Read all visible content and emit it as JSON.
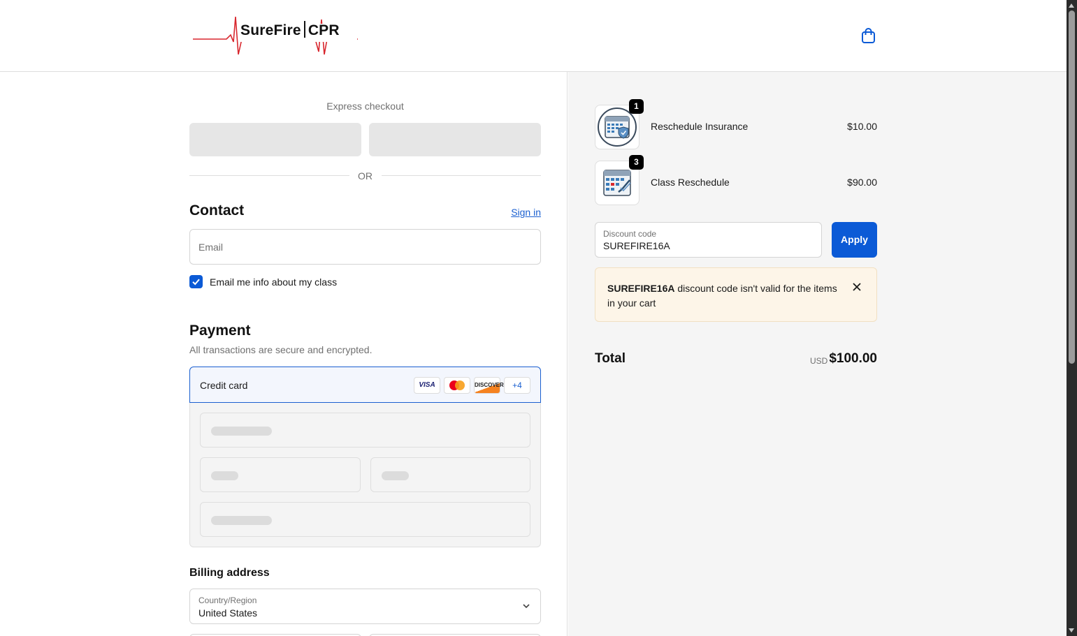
{
  "brand": {
    "logo_text_left": "SureFire",
    "logo_text_right": "CPR",
    "accent": "#0b5ad6",
    "logo_red": "#d8272e"
  },
  "header": {
    "cart_icon": "shopping-bag-icon"
  },
  "express": {
    "label": "Express checkout",
    "or": "OR"
  },
  "contact": {
    "title": "Contact",
    "signin": "Sign in",
    "email_placeholder": "Email",
    "opt_in_label": "Email me info about my class",
    "opt_in_checked": true
  },
  "payment": {
    "title": "Payment",
    "subtitle": "All transactions are secure and encrypted.",
    "method_label": "Credit card",
    "cards": [
      "VISA",
      "mastercard",
      "DISCOVER",
      "+4"
    ]
  },
  "billing": {
    "title": "Billing address",
    "country_label": "Country/Region",
    "country_value": "United States"
  },
  "cart": {
    "items": [
      {
        "name": "Reschedule Insurance",
        "price": "$10.00",
        "qty": "1",
        "icon": "calendar-shield-icon"
      },
      {
        "name": "Class Reschedule",
        "price": "$90.00",
        "qty": "3",
        "icon": "calendar-check-icon"
      }
    ],
    "discount_label": "Discount code",
    "discount_value": "SUREFIRE16A",
    "apply": "Apply",
    "notice_code": "SUREFIRE16A",
    "notice_text": " discount code isn't valid for the items in your cart",
    "total_label": "Total",
    "total_currency": "USD",
    "total_value": "$100.00"
  }
}
